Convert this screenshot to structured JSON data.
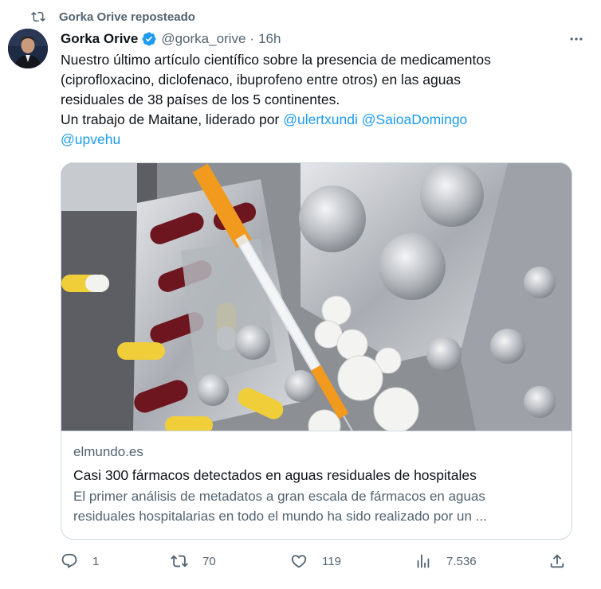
{
  "repost": {
    "icon": "repost-icon",
    "text": "Gorka Orive reposteado"
  },
  "tweet": {
    "author_name": "Gorka Orive",
    "verified": true,
    "handle": "@gorka_orive",
    "separator": "·",
    "time": "16h",
    "text_lines": [
      "Nuestro último artículo científico sobre la presencia de medicamentos",
      "(ciprofloxacino, diclofenaco, ibuprofeno entre otros) en las aguas",
      "residuales de 38 países de los 5 continentes.",
      "Un trabajo de Maitane, liderado por "
    ],
    "mentions": [
      "@ulertxundi",
      "@SaioaDomingo",
      "@upvehu"
    ]
  },
  "card": {
    "image_alt": "Blísteres de pastillas, cápsulas y una jeringa",
    "domain": "elmundo.es",
    "title": "Casi 300 fármacos detectados en aguas residuales de hospitales",
    "description_line1": "El primer análisis de metadatos a gran escala de fármacos en aguas",
    "description_line2": "residuales hospitalarias en todo el mundo ha sido realizado por un ..."
  },
  "actions": {
    "replies": "1",
    "reposts": "70",
    "likes": "119",
    "views": "7.536"
  },
  "colors": {
    "text_primary": "#0f1419",
    "text_secondary": "#536471",
    "link": "#1d9bf0",
    "border": "#cfd9de",
    "verified": "#1d9bf0"
  }
}
